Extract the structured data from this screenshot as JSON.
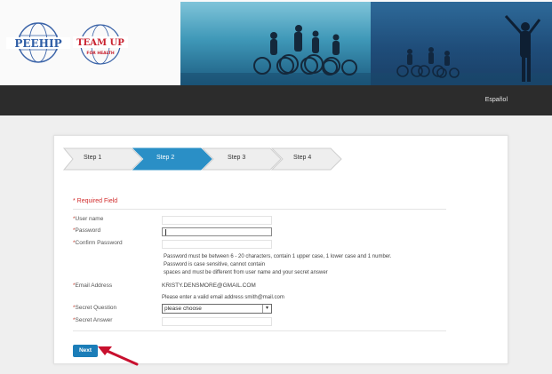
{
  "header": {
    "logo_peehip": "PEEHIP",
    "logo_teamup_line1": "TEAM UP",
    "logo_teamup_line2": "FOR HEALTH",
    "language_link": "Español"
  },
  "steps": [
    "Step 1",
    "Step 2",
    "Step 3",
    "Step 4"
  ],
  "active_step_index": 1,
  "form": {
    "required_note": "* Required Field",
    "username_label": "User name",
    "password_label": "Password",
    "confirm_password_label": "Confirm Password",
    "password_help_1": "Password must be between 6 - 20 characters, contain 1 upper case, 1 lower case and 1 number.",
    "password_help_2": "Password is case sensitive, cannot contain",
    "password_help_3": "spaces and must be different from user name and your secret answer",
    "email_label": "Email Address",
    "email_value": "KRISTY.DENSMORE@GMAIL.COM",
    "email_help": "Please enter a valid email address smith@mail.com",
    "secret_question_label": "Secret Question",
    "secret_question_value": "please choose",
    "secret_answer_label": "Secret Answer",
    "next_label": "Next"
  },
  "colors": {
    "accent": "#1b7db8",
    "required": "#d12b2b",
    "navbar": "#2c2c2c",
    "arrow": "#c8102e"
  }
}
